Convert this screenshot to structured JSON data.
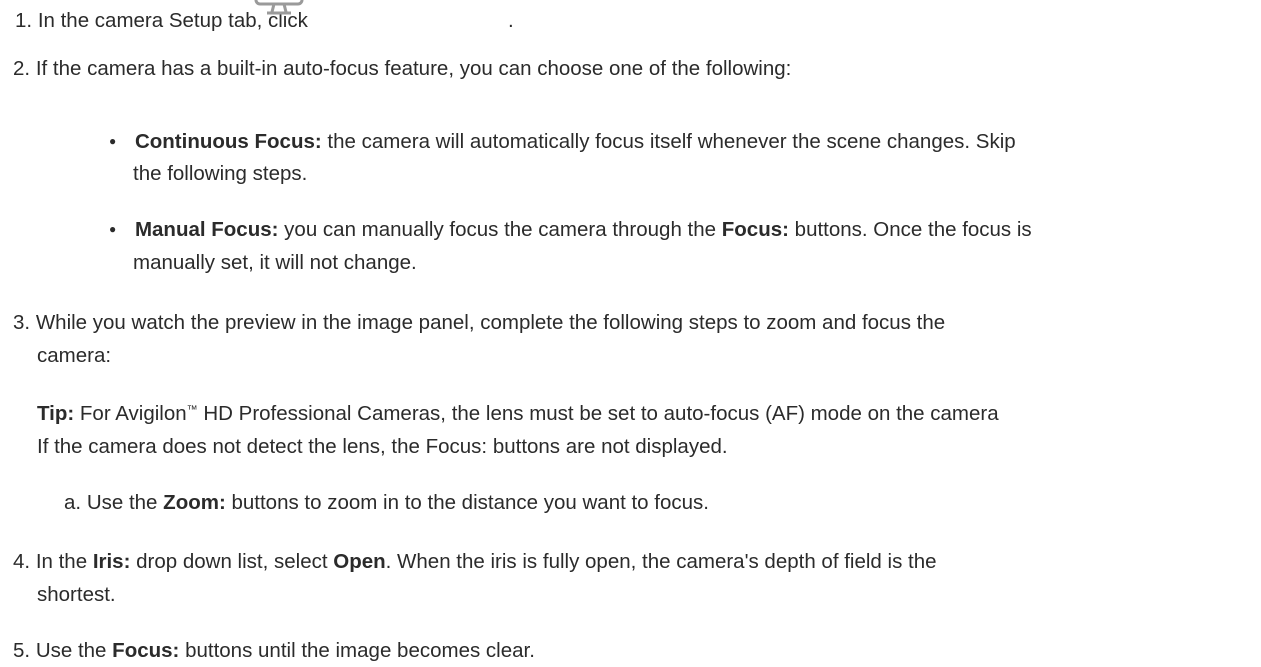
{
  "steps": {
    "s1": {
      "num": "1.",
      "text": "In the camera Setup tab, click",
      "after_icon": ".",
      "icon": "monitor-icon"
    },
    "s2": {
      "num": "2.",
      "text": "If the camera has a built-in auto-focus feature, you can choose one of the following:"
    },
    "bullet1": {
      "label": "Continuous Focus:",
      "line1": " the camera will automatically focus itself whenever the scene changes. Skip",
      "line2": "the following steps."
    },
    "bullet2": {
      "label": "Manual Focus:",
      "text1": " you can manually focus the camera through the ",
      "focus": "Focus:",
      "text2": " buttons. Once the focus is",
      "line2": "manually set, it will not change."
    },
    "s3": {
      "num": "3.",
      "line1": "While you watch the preview in the image panel, complete the following steps to zoom and focus the",
      "line2": "camera:"
    },
    "tip": {
      "label": "Tip:",
      "line1a": " For Avigilon",
      "tm": "™",
      "line1b": " HD Professional Cameras, the lens must be set to auto-focus (AF) mode on the camera",
      "line2": "If the camera does not detect the lens, the Focus: buttons are not displayed."
    },
    "sa": {
      "num": "a.",
      "text1": "Use the ",
      "bold": "Zoom:",
      "text2": " buttons to zoom in to the distance you want to focus."
    },
    "s4": {
      "num": "4.",
      "text1": "In the ",
      "iris": "Iris:",
      "text2": " drop down list, select ",
      "open": "Open",
      "text3": ". When the iris is fully open, the camera's depth of field is the",
      "line2": "shortest."
    },
    "s5": {
      "num": "5.",
      "text1": "Use the ",
      "bold": "Focus:",
      "text2": " buttons until the image becomes clear."
    }
  }
}
